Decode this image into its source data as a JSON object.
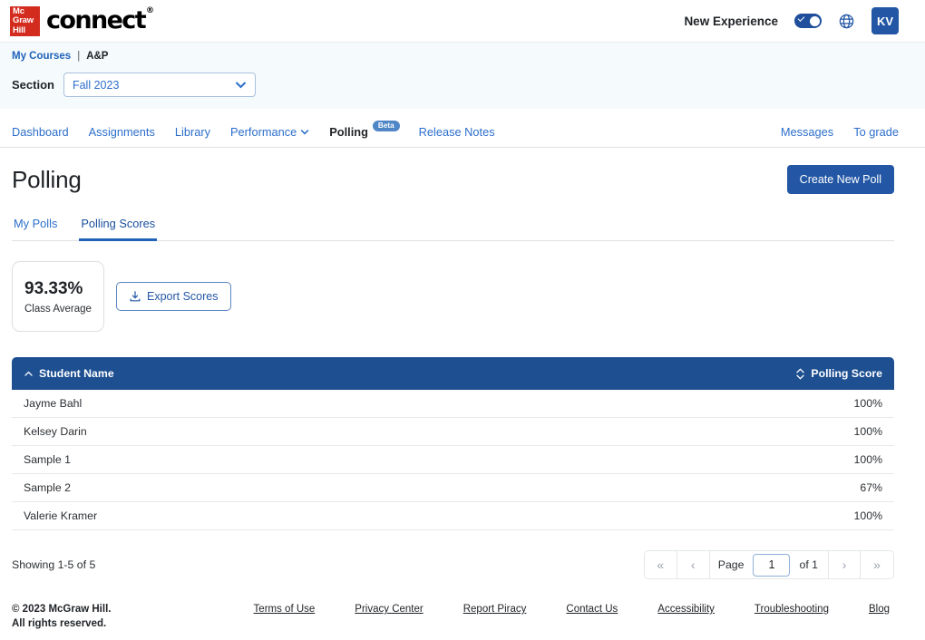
{
  "topbar": {
    "logo_mark_lines": [
      "Mc",
      "Graw",
      "Hill"
    ],
    "logo_word": "connect",
    "new_experience_label": "New Experience",
    "toggle_state": "on",
    "globe_icon": "globe-icon",
    "avatar_initials": "KV",
    "brand_red": "#d42b1f",
    "brand_blue": "#2357a5"
  },
  "breadcrumb": {
    "my_courses": "My Courses",
    "separator": "|",
    "current": "A&P"
  },
  "section": {
    "label": "Section",
    "selected": "Fall 2023",
    "chevron_icon": "chevron-down-icon"
  },
  "mainnav": {
    "items": [
      {
        "label": "Dashboard",
        "active": false
      },
      {
        "label": "Assignments",
        "active": false
      },
      {
        "label": "Library",
        "active": false
      },
      {
        "label": "Performance",
        "active": false,
        "caret": true
      },
      {
        "label": "Polling",
        "active": true,
        "badge": "Beta"
      },
      {
        "label": "Release Notes",
        "active": false
      }
    ],
    "right_items": [
      {
        "label": "Messages"
      },
      {
        "label": "To grade"
      }
    ]
  },
  "page": {
    "title": "Polling",
    "create_poll_button": "Create New Poll"
  },
  "tabs": [
    {
      "label": "My Polls",
      "active": false
    },
    {
      "label": "Polling Scores",
      "active": true
    }
  ],
  "stats": {
    "class_average_value": "93.33%",
    "class_average_label": "Class Average",
    "export_button": "Export Scores",
    "export_icon": "download-icon"
  },
  "table": {
    "columns": [
      {
        "label": "Student Name",
        "sort_icon": "chevron-up-icon",
        "align": "left"
      },
      {
        "label": "Polling Score",
        "sort_icon": "sort-both-icon",
        "align": "right"
      }
    ],
    "header_bg": "#1d4f91",
    "rows": [
      {
        "name": "Jayme Bahl",
        "score": "100%"
      },
      {
        "name": "Kelsey Darin",
        "score": "100%"
      },
      {
        "name": "Sample 1",
        "score": "100%"
      },
      {
        "name": "Sample 2",
        "score": "67%"
      },
      {
        "name": "Valerie Kramer",
        "score": "100%"
      }
    ]
  },
  "pagination": {
    "showing": "Showing 1-5 of 5",
    "first_icon": "«",
    "prev_icon": "‹",
    "page_label": "Page",
    "page_value": "1",
    "of_label": "of 1",
    "next_icon": "›",
    "last_icon": "»"
  },
  "footer": {
    "copyright_line1": "© 2023 McGraw Hill.",
    "copyright_line2": "All rights reserved.",
    "links": [
      "Terms of Use",
      "Privacy Center",
      "Report Piracy",
      "Contact Us",
      "Accessibility",
      "Troubleshooting",
      "Blog"
    ]
  }
}
